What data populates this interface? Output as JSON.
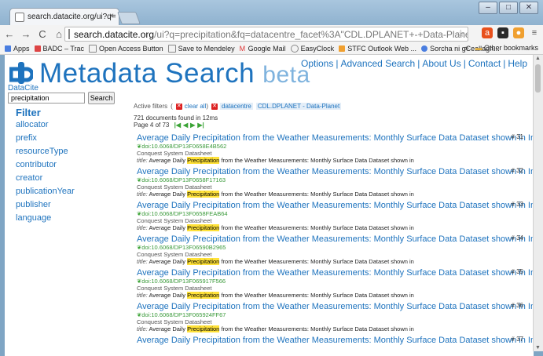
{
  "browser": {
    "tab_title": "search.datacite.org/ui?q=",
    "tab_close": "×",
    "url_host": "search.datacite.org",
    "url_path": "/ui?q=precipitation&fq=datacentre_facet%3A\"CDL.DPLANET+-+Data-Planet\"&start=30",
    "bookmarks": [
      "Apps",
      "BADC – Trac",
      "Open Access Button",
      "Save to Mendeley",
      "Google Mail",
      "EasyClock",
      "STFC Outlook Web ...",
      "Sorcha ni gCeallagh..."
    ],
    "bookmarks_more": "»",
    "other_bookmarks": "Other bookmarks"
  },
  "site": {
    "title": "Metadata Search",
    "beta": "beta",
    "datacite": "DataCite",
    "nav": [
      "Options",
      "Advanced Search",
      "About Us",
      "Contact",
      "Help"
    ],
    "search_value": "precipitation",
    "search_button": "Search"
  },
  "filters": {
    "heading": "Filter",
    "facets": [
      "allocator",
      "prefix",
      "resourceType",
      "contributor",
      "creator",
      "publicationYear",
      "publisher",
      "language"
    ]
  },
  "active_filters": {
    "label": "Active filters",
    "clear": "clear all",
    "datacentre_key": "datacentre",
    "datacentre_value": "CDL.DPLANET - Data-Planet"
  },
  "summary": {
    "found": "721 documents found in 12ms",
    "page": "Page 4 of 73"
  },
  "results": [
    {
      "title": "Average Daily Precipitation from the Weather Measurements: Monthly Surface Data Dataset shown in Inches",
      "num": "# 31",
      "doi": "doi:10.6068/DP13F0658E4B562",
      "src": "Conquest System Datasheet",
      "tl_label": "title:",
      "tl_a": "Average Daily ",
      "tl_hl": "Precipitation",
      "tl_b": " from the Weather Measurements: Monthly Surface Data Dataset shown in"
    },
    {
      "title": "Average Daily Precipitation from the Weather Measurements: Monthly Surface Data Dataset shown in Inches",
      "num": "# 32",
      "doi": "doi:10.6068/DP13F0658F17163",
      "src": "Conquest System Datasheet",
      "tl_label": "title:",
      "tl_a": "Average Daily ",
      "tl_hl": "Precipitation",
      "tl_b": " from the Weather Measurements: Monthly Surface Data Dataset shown in"
    },
    {
      "title": "Average Daily Precipitation from the Weather Measurements: Monthly Surface Data Dataset shown in Inches",
      "num": "# 33",
      "doi": "doi:10.6068/DP13F0658FEAB64",
      "src": "Conquest System Datasheet",
      "tl_label": "title:",
      "tl_a": "Average Daily ",
      "tl_hl": "Precipitation",
      "tl_b": " from the Weather Measurements: Monthly Surface Data Dataset shown in"
    },
    {
      "title": "Average Daily Precipitation from the Weather Measurements: Monthly Surface Data Dataset shown in Inches",
      "num": "# 34",
      "doi": "doi:10.6068/DP13F06590B2965",
      "src": "Conquest System Datasheet",
      "tl_label": "title:",
      "tl_a": "Average Daily ",
      "tl_hl": "Precipitation",
      "tl_b": " from the Weather Measurements: Monthly Surface Data Dataset shown in"
    },
    {
      "title": "Average Daily Precipitation from the Weather Measurements: Monthly Surface Data Dataset shown in Inches",
      "num": "# 35",
      "doi": "doi:10.6068/DP13F065917F566",
      "src": "Conquest System Datasheet",
      "tl_label": "title:",
      "tl_a": "Average Daily ",
      "tl_hl": "Precipitation",
      "tl_b": " from the Weather Measurements: Monthly Surface Data Dataset shown in"
    },
    {
      "title": "Average Daily Precipitation from the Weather Measurements: Monthly Surface Data Dataset shown in Inches",
      "num": "# 36",
      "doi": "doi:10.6068/DP13F065924FF67",
      "src": "Conquest System Datasheet",
      "tl_label": "title:",
      "tl_a": "Average Daily ",
      "tl_hl": "Precipitation",
      "tl_b": " from the Weather Measurements: Monthly Surface Data Dataset shown in"
    },
    {
      "title": "Average Daily Precipitation from the Weather Measurements: Monthly Surface Data Dataset shown in Inches",
      "num": "# 37",
      "doi": "",
      "src": "",
      "tl_label": "",
      "tl_a": "",
      "tl_hl": "",
      "tl_b": ""
    }
  ],
  "colors": {
    "link": "#1e73be",
    "highlight": "#ffe23a",
    "doi": "#3a9a3a"
  }
}
